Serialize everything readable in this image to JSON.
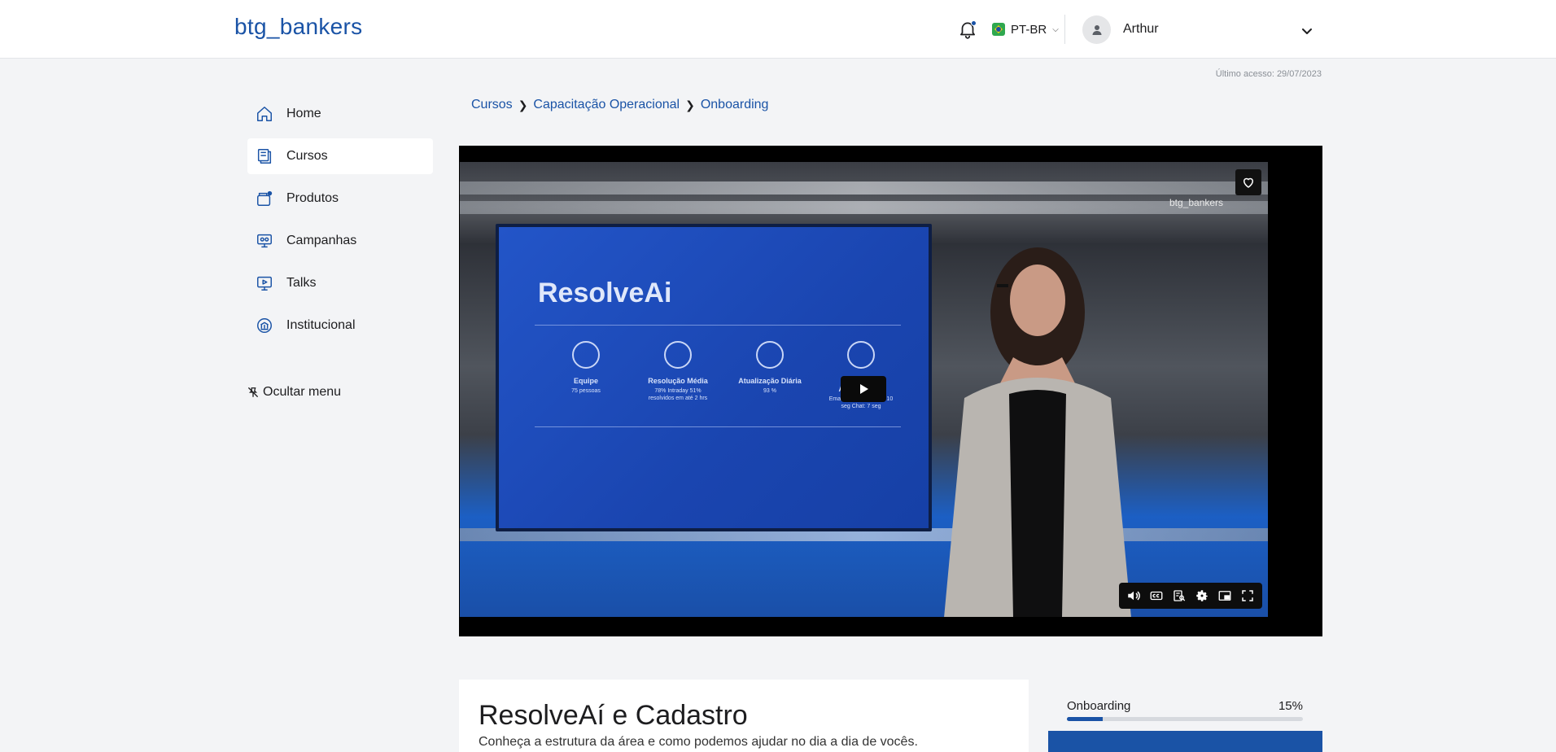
{
  "header": {
    "logo": "btg_bankers",
    "language": "PT-BR",
    "user_name": "Arthur"
  },
  "last_access": "Último acesso: 29/07/2023",
  "sidebar": {
    "items": [
      {
        "label": "Home",
        "icon": "home-icon"
      },
      {
        "label": "Cursos",
        "icon": "courses-icon",
        "active": true
      },
      {
        "label": "Produtos",
        "icon": "products-icon"
      },
      {
        "label": "Campanhas",
        "icon": "campaigns-icon"
      },
      {
        "label": "Talks",
        "icon": "talks-icon"
      },
      {
        "label": "Institucional",
        "icon": "institutional-icon"
      }
    ],
    "hide_menu": "Ocultar menu"
  },
  "breadcrumb": [
    "Cursos",
    "Capacitação Operacional",
    "Onboarding"
  ],
  "video": {
    "watermark": "btg_bankers",
    "slide": {
      "title": "ResolveAi",
      "stats": [
        {
          "title": "Equipe",
          "sub": "75 pessoas"
        },
        {
          "title": "Resolução Média",
          "sub": "78% Intraday 51% resolvidos em até 2 hrs"
        },
        {
          "title": "Atualização Diária",
          "sub": "93 %"
        },
        {
          "title": "Primeiro Atendimento",
          "sub": "Email: 5 min Telefone: 10 seg Chat: 7 seg"
        }
      ]
    }
  },
  "lesson": {
    "title": "ResolveAí e Cadastro",
    "description": "Conheça a estrutura da área e como podemos ajudar no dia a dia de vocês."
  },
  "progress": {
    "label": "Onboarding",
    "percent_label": "15%",
    "percent": 15
  },
  "colors": {
    "accent": "#1a53a6",
    "background": "#f3f4f6"
  }
}
